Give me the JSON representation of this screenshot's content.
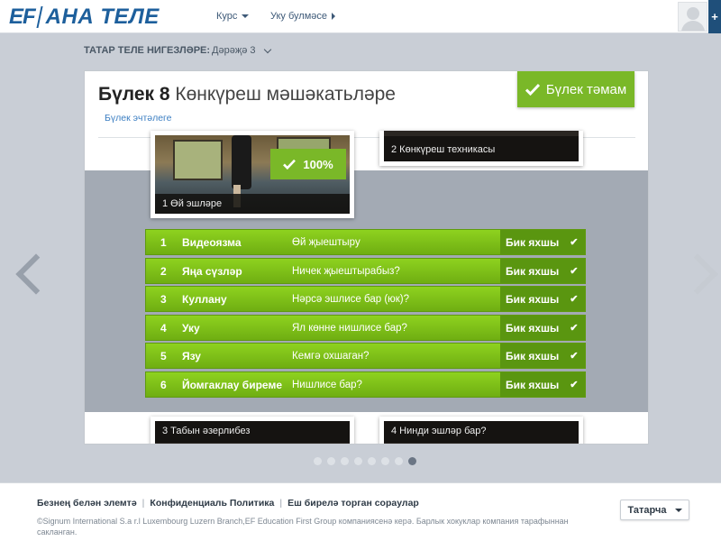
{
  "brand": {
    "ef": "EF",
    "name": "АНА ТЕЛЕ"
  },
  "nav": {
    "course_label": "Курс",
    "study_label": "Уку булмәсе"
  },
  "header_plus": "+",
  "level": {
    "label": "ТАТАР ТЕЛЕ НИГЕЗЛӘРЕ:",
    "value": "Дәрәҗә 3"
  },
  "unit": {
    "number": "Бүлек 8",
    "name": "Көнкүреш мәшәкатьләре",
    "contents_link": "Бүлек эчтәлеге",
    "complete_button": "Бүлек тәмам"
  },
  "lessons": [
    {
      "caption": "1 Өй эшләре",
      "score": "100%"
    },
    {
      "caption": "2 Көнкүреш техникасы"
    },
    {
      "caption": "3 Табын әзерлибез"
    },
    {
      "caption": "4 Нинди эшләр бар?"
    }
  ],
  "activities": [
    {
      "num": "1",
      "type": "Видеоязма",
      "desc": "Өй җыештыру",
      "grade": "Бик яхшы"
    },
    {
      "num": "2",
      "type": "Яңа сүзләр",
      "desc": "Ничек җыештырабыз?",
      "grade": "Бик яхшы"
    },
    {
      "num": "3",
      "type": "Куллану",
      "desc": "Нәрсә эшлисе бар (юк)?",
      "grade": "Бик яхшы"
    },
    {
      "num": "4",
      "type": "Уку",
      "desc": "Ял көнне нишлисе бар?",
      "grade": "Бик яхшы"
    },
    {
      "num": "5",
      "type": "Язу",
      "desc": "Кемгә охшаган?",
      "grade": "Бик яхшы"
    },
    {
      "num": "6",
      "type": "Йомгаклау биреме",
      "desc": "Нишлисе бар?",
      "grade": "Бик яхшы"
    }
  ],
  "pager": {
    "total": 8,
    "active_index": 8
  },
  "footer": {
    "links": [
      "Безнең белән элемтә",
      "Конфиденциаль Политика",
      "Еш бирелә торган сораулар"
    ],
    "copyright": "©Signum International S.a r.l Luxembourg Luzern Branch,EF Education First Group компаниясенә керә. Барлык хокуклар компания тарафыннан сакланган.",
    "language": "Татарча"
  },
  "colors": {
    "brand_blue": "#1d5f9c",
    "accent_green": "#7ab828",
    "grade_green": "#5a9610",
    "link_blue": "#3b7ec2"
  }
}
